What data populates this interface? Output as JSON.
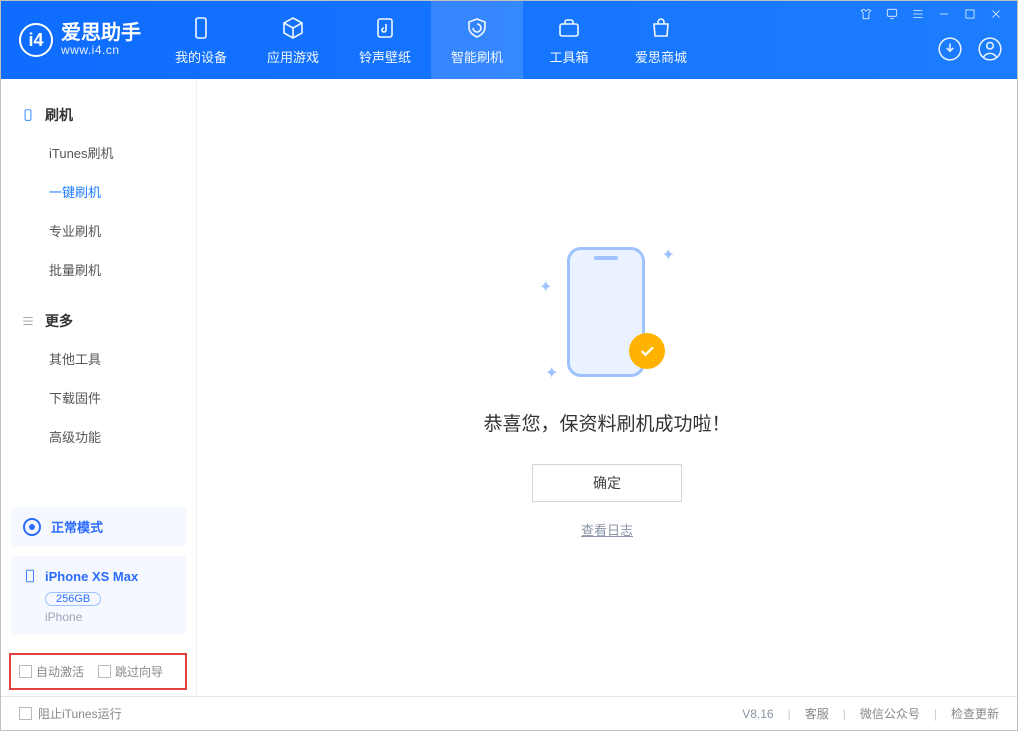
{
  "header": {
    "app_name": "爱思助手",
    "app_url": "www.i4.cn",
    "nav": [
      {
        "id": "device",
        "label": "我的设备"
      },
      {
        "id": "apps",
        "label": "应用游戏"
      },
      {
        "id": "media",
        "label": "铃声壁纸"
      },
      {
        "id": "flash",
        "label": "智能刷机",
        "active": true
      },
      {
        "id": "tools",
        "label": "工具箱"
      },
      {
        "id": "store",
        "label": "爱思商城"
      }
    ]
  },
  "sidebar": {
    "group1_label": "刷机",
    "group1_items": [
      {
        "id": "itunes",
        "label": "iTunes刷机"
      },
      {
        "id": "oneclick",
        "label": "一键刷机",
        "active": true
      },
      {
        "id": "pro",
        "label": "专业刷机"
      },
      {
        "id": "batch",
        "label": "批量刷机"
      }
    ],
    "group2_label": "更多",
    "group2_items": [
      {
        "id": "other",
        "label": "其他工具"
      },
      {
        "id": "firmware",
        "label": "下载固件"
      },
      {
        "id": "adv",
        "label": "高级功能"
      }
    ],
    "mode_label": "正常模式",
    "device": {
      "name": "iPhone XS Max",
      "capacity": "256GB",
      "type": "iPhone"
    },
    "opt_auto_activate": "自动激活",
    "opt_skip_guide": "跳过向导"
  },
  "main": {
    "success_message": "恭喜您，保资料刷机成功啦！",
    "ok_button": "确定",
    "view_log": "查看日志"
  },
  "footer": {
    "block_itunes": "阻止iTunes运行",
    "version": "V8.16",
    "links": {
      "service": "客服",
      "wechat": "微信公众号",
      "update": "检查更新"
    }
  }
}
